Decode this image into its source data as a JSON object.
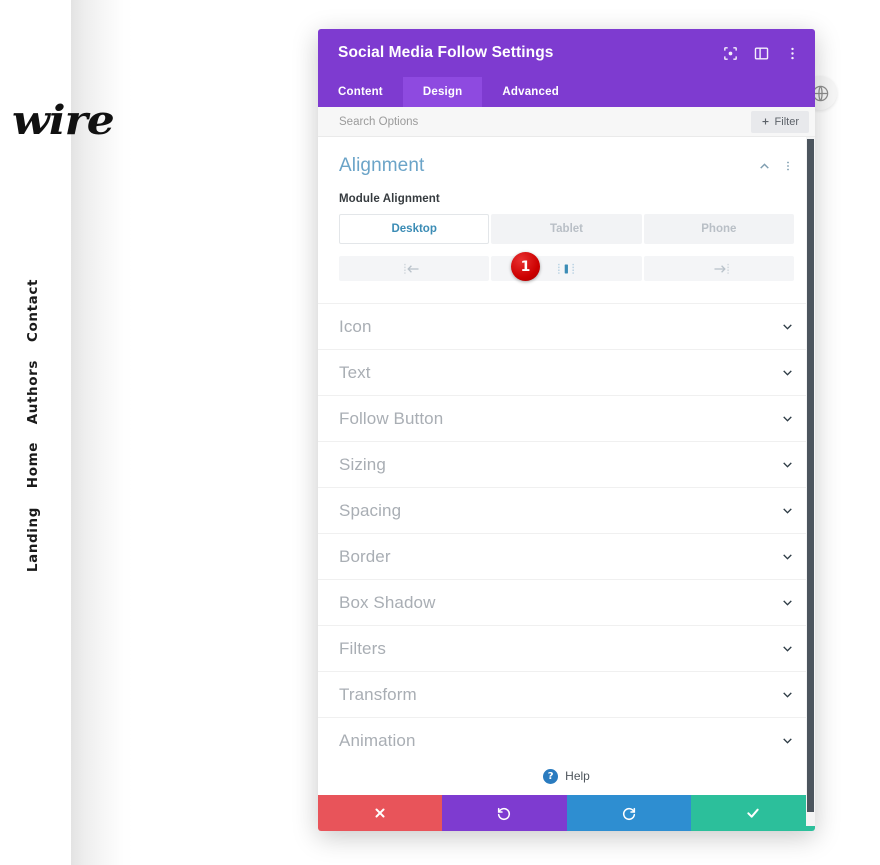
{
  "site": {
    "logo_text": "wire",
    "nav_items": [
      {
        "label": "Contact"
      },
      {
        "label": "Authors"
      },
      {
        "label": "Home"
      },
      {
        "label": "Landing"
      }
    ],
    "globe_icon": "globe-icon"
  },
  "modal": {
    "title": "Social Media Follow Settings",
    "header_icons": [
      {
        "name": "focus-target-icon"
      },
      {
        "name": "layout-panel-icon"
      },
      {
        "name": "kebab-menu-icon"
      }
    ],
    "tabs": [
      {
        "label": "Content",
        "active": false
      },
      {
        "label": "Design",
        "active": true
      },
      {
        "label": "Advanced",
        "active": false
      }
    ],
    "search": {
      "placeholder": "Search Options",
      "value": ""
    },
    "filter_button": {
      "label": "Filter",
      "icon": "plus-icon"
    },
    "alignment": {
      "title": "Alignment",
      "collapse_icon": "chevron-up-icon",
      "menu_icon": "kebab-menu-icon",
      "field_label": "Module Alignment",
      "devices": [
        {
          "label": "Desktop",
          "active": true
        },
        {
          "label": "Tablet",
          "active": false
        },
        {
          "label": "Phone",
          "active": false
        }
      ],
      "align_options": [
        {
          "name": "align-left-icon",
          "active": false
        },
        {
          "name": "align-center-icon",
          "active": true
        },
        {
          "name": "align-right-icon",
          "active": false
        }
      ],
      "badge_number": "1"
    },
    "sections": [
      {
        "label": "Icon",
        "chevron": "chevron-down-icon"
      },
      {
        "label": "Text",
        "chevron": "chevron-down-icon"
      },
      {
        "label": "Follow Button",
        "chevron": "chevron-down-icon"
      },
      {
        "label": "Sizing",
        "chevron": "chevron-down-icon"
      },
      {
        "label": "Spacing",
        "chevron": "chevron-down-icon"
      },
      {
        "label": "Border",
        "chevron": "chevron-down-icon"
      },
      {
        "label": "Box Shadow",
        "chevron": "chevron-down-icon"
      },
      {
        "label": "Filters",
        "chevron": "chevron-down-icon"
      },
      {
        "label": "Transform",
        "chevron": "chevron-down-icon"
      },
      {
        "label": "Animation",
        "chevron": "chevron-down-icon"
      }
    ],
    "help": {
      "label": "Help",
      "icon": "question-mark-icon"
    },
    "footer_buttons": [
      {
        "name": "cancel-button",
        "icon": "close-x-icon",
        "color": "#e8545a"
      },
      {
        "name": "undo-button",
        "icon": "undo-icon",
        "color": "#7e3bd0"
      },
      {
        "name": "redo-button",
        "icon": "redo-icon",
        "color": "#2e8ed1"
      },
      {
        "name": "save-button",
        "icon": "check-icon",
        "color": "#2cbf9b"
      }
    ]
  },
  "colors": {
    "modal_header": "#7e3bd0",
    "tab_active": "#8e4ae0",
    "accent_blue": "#3b8cb5",
    "title_blue": "#6ba4c8",
    "badge_red": "#cc0000"
  }
}
